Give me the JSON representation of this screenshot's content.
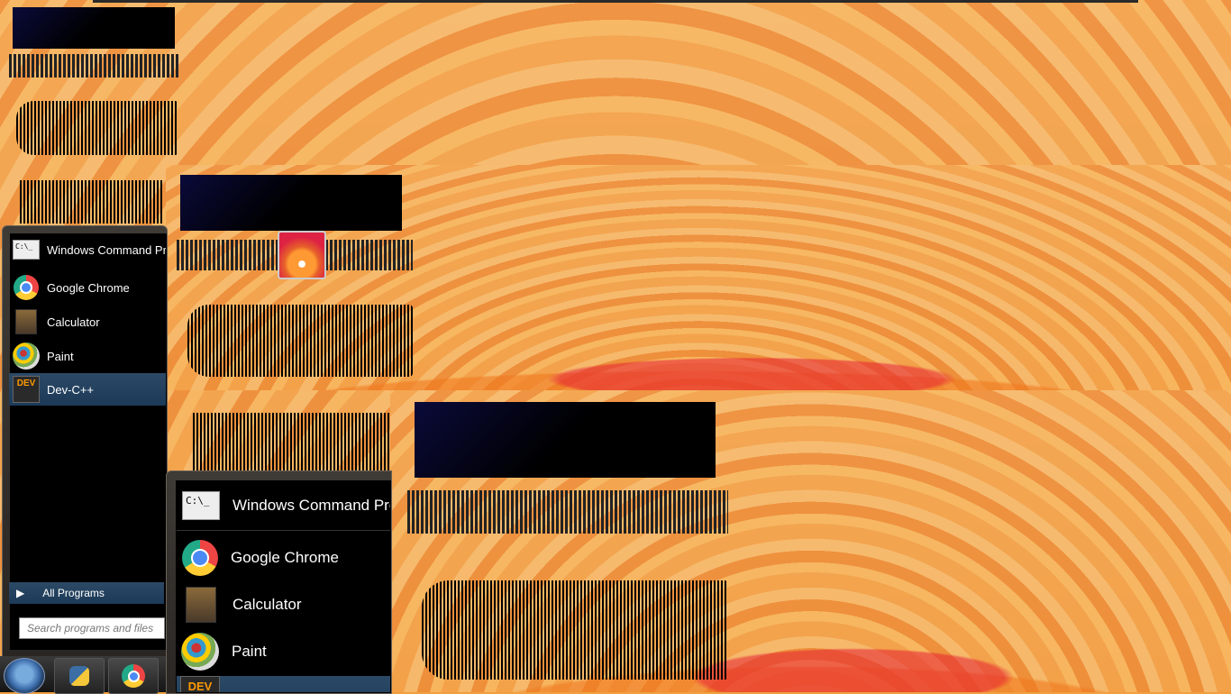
{
  "start_menu_small": {
    "items": [
      {
        "label": "Windows Command Prompt",
        "icon": "cmd-icon"
      },
      {
        "label": "Google Chrome",
        "icon": "chrome-icon"
      },
      {
        "label": "Calculator",
        "icon": "calculator-icon"
      },
      {
        "label": "Paint",
        "icon": "paint-icon"
      },
      {
        "label": "Dev-C++",
        "icon": "devcpp-icon"
      }
    ],
    "all_programs": "All Programs",
    "search_placeholder": "Search programs and files"
  },
  "start_menu_large": {
    "items": [
      {
        "label": "Windows Command Prompt",
        "icon": "cmd-icon"
      },
      {
        "label": "Google Chrome",
        "icon": "chrome-icon"
      },
      {
        "label": "Calculator",
        "icon": "calculator-icon"
      },
      {
        "label": "Paint",
        "icon": "paint-icon"
      }
    ]
  },
  "icons": {
    "cmd_text": "C:\\_",
    "dev_text": "DEV"
  },
  "colors": {
    "selection": "#2c4a66",
    "wallpaper": "#f0a040"
  }
}
